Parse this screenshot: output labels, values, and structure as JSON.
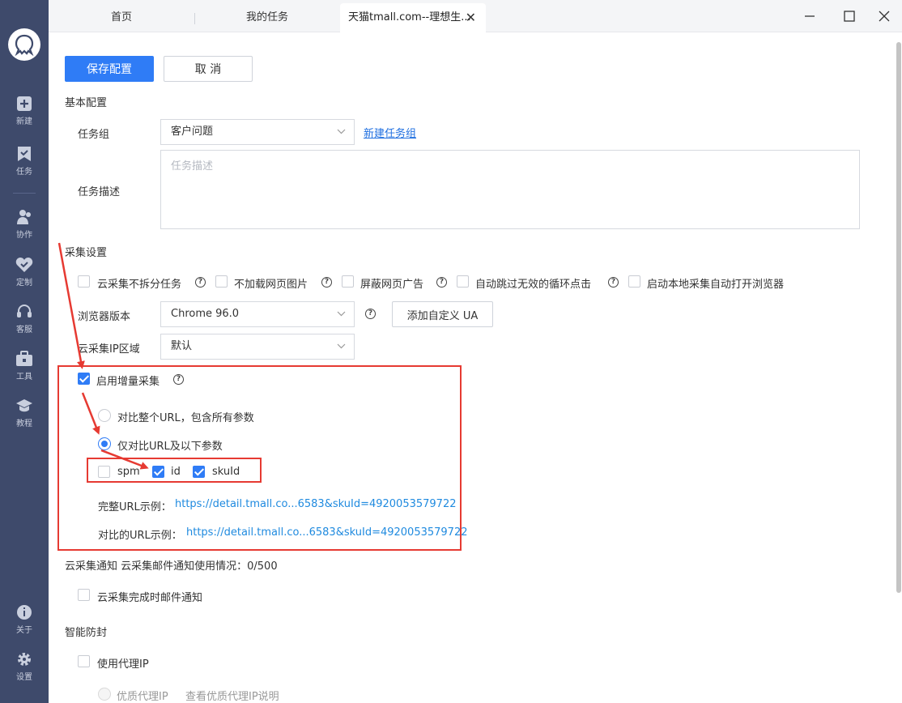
{
  "sidebar": {
    "items": [
      {
        "label": "新建",
        "icon": "plus-square-icon"
      },
      {
        "label": "任务",
        "icon": "task-flag-icon"
      },
      {
        "label": "协作",
        "icon": "people-icon"
      },
      {
        "label": "定制",
        "icon": "heart-check-icon"
      },
      {
        "label": "客服",
        "icon": "headset-icon"
      },
      {
        "label": "工具",
        "icon": "toolbox-icon"
      },
      {
        "label": "教程",
        "icon": "graduation-cap-icon"
      }
    ],
    "bottom_items": [
      {
        "label": "关于",
        "icon": "info-icon"
      },
      {
        "label": "设置",
        "icon": "gear-icon"
      }
    ]
  },
  "tabs": [
    {
      "label": "首页"
    },
    {
      "label": "我的任务"
    },
    {
      "label": "天猫tmall.com--理想生..."
    }
  ],
  "toolbar": {
    "save_label": "保存配置",
    "cancel_label": "取 消"
  },
  "basic": {
    "title": "基本配置",
    "group_label": "任务组",
    "group_value": "客户问题",
    "new_group_link": "新建任务组",
    "desc_label": "任务描述",
    "desc_placeholder": "任务描述"
  },
  "collect": {
    "title": "采集设置",
    "options": [
      {
        "label": "云采集不拆分任务",
        "checked": false,
        "help": true
      },
      {
        "label": "不加载网页图片",
        "checked": false,
        "help": true
      },
      {
        "label": "屏蔽网页广告",
        "checked": false,
        "help": true
      },
      {
        "label": "自动跳过无效的循环点击",
        "checked": false,
        "help": true
      },
      {
        "label": "启动本地采集自动打开浏览器",
        "checked": false,
        "help": false
      }
    ],
    "browser_label": "浏览器版本",
    "browser_value": "Chrome 96.0",
    "ua_button": "添加自定义 UA",
    "ip_label": "云采集IP区域",
    "ip_value": "默认"
  },
  "incremental": {
    "label": "启用增量采集",
    "checked": true,
    "radio_full": "对比整个URL，包含所有参数",
    "radio_partial": "仅对比URL及以下参数",
    "selected": "partial",
    "params": [
      {
        "name": "spm",
        "checked": false
      },
      {
        "name": "id",
        "checked": true
      },
      {
        "name": "skuId",
        "checked": true
      }
    ],
    "full_url_label": "完整URL示例：",
    "full_url": "https://detail.tmall.co...6583&skuId=4920053579722",
    "compare_url_label": "对比的URL示例：",
    "compare_url": "https://detail.tmall.co...6583&skuId=4920053579722"
  },
  "notify": {
    "title": "云采集通知 云采集邮件通知使用情况：0/500",
    "email_label": "云采集完成时邮件通知"
  },
  "antiblock": {
    "title": "智能防封",
    "proxy_label": "使用代理IP",
    "quality_proxy": "优质代理IP",
    "quality_link": "查看优质代理IP说明"
  },
  "colors": {
    "primary": "#2f7cf6",
    "sidebar": "#3e4a6b",
    "annotation": "#e63a32",
    "link": "#1f6fe0"
  }
}
